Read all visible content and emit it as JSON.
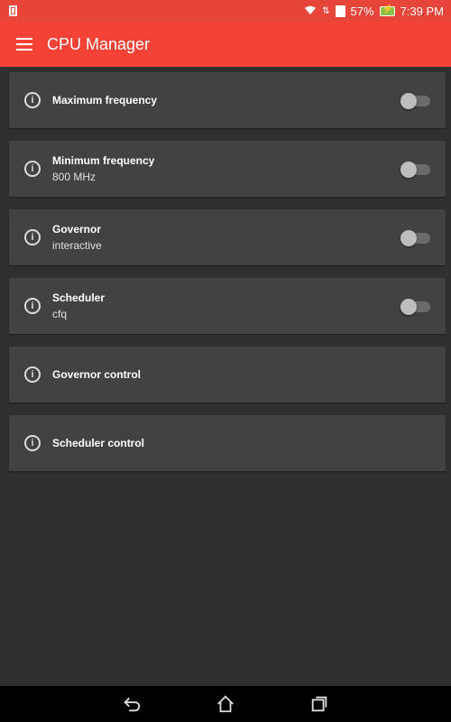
{
  "status_bar": {
    "battery_percent": "57%",
    "time": "7:39 PM"
  },
  "app_bar": {
    "title": "CPU Manager",
    "menu_icon": "menu-icon"
  },
  "settings": [
    {
      "title": "Maximum frequency",
      "subtitle": "",
      "has_switch": true,
      "switch_on": false
    },
    {
      "title": "Minimum frequency",
      "subtitle": "800 MHz",
      "has_switch": true,
      "switch_on": false
    },
    {
      "title": "Governor",
      "subtitle": "interactive",
      "has_switch": true,
      "switch_on": false
    },
    {
      "title": "Scheduler",
      "subtitle": "cfq",
      "has_switch": true,
      "switch_on": false
    },
    {
      "title": "Governor control",
      "subtitle": "",
      "has_switch": false
    },
    {
      "title": "Scheduler control",
      "subtitle": "",
      "has_switch": false
    }
  ],
  "nav_bar": {
    "icons": [
      "back-icon",
      "home-icon",
      "recents-icon"
    ]
  },
  "colors": {
    "accent": "#f44336",
    "status_bar": "#e8453a",
    "background": "#303030",
    "card": "#424242"
  }
}
